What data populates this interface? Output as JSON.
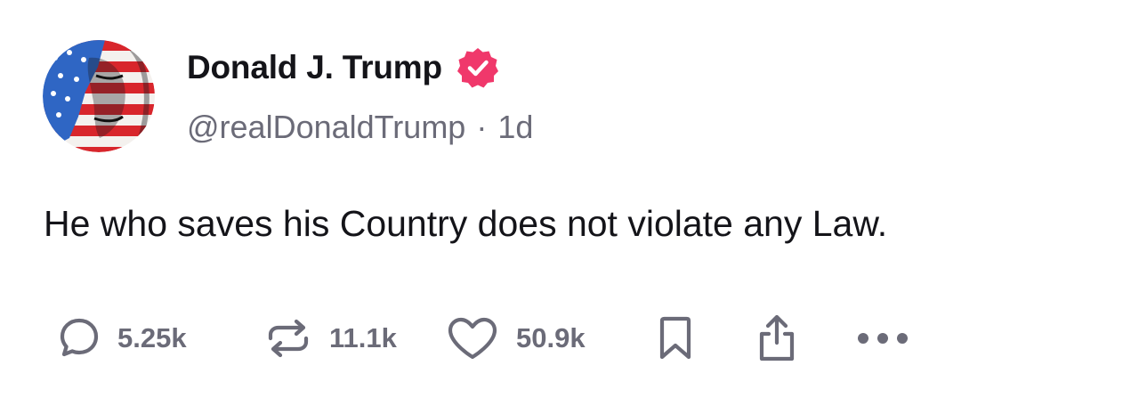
{
  "author": {
    "display_name": "Donald J. Trump",
    "handle": "@realDonaldTrump",
    "separator": "·",
    "timestamp": "1d",
    "verified": true,
    "badge_color": "#f0386b"
  },
  "post": {
    "text": "He who saves his Country does not violate any Law."
  },
  "actions": {
    "replies": "5.25k",
    "reposts": "11.1k",
    "likes": "50.9k"
  },
  "colors": {
    "text_primary": "#141419",
    "text_secondary": "#6b6b78",
    "icon": "#6b6b78"
  },
  "icons": {
    "reply": "speech-bubble-icon",
    "repost": "repost-arrows-icon",
    "like": "heart-icon",
    "bookmark": "bookmark-icon",
    "share": "share-icon",
    "more": "more-dots-icon"
  }
}
